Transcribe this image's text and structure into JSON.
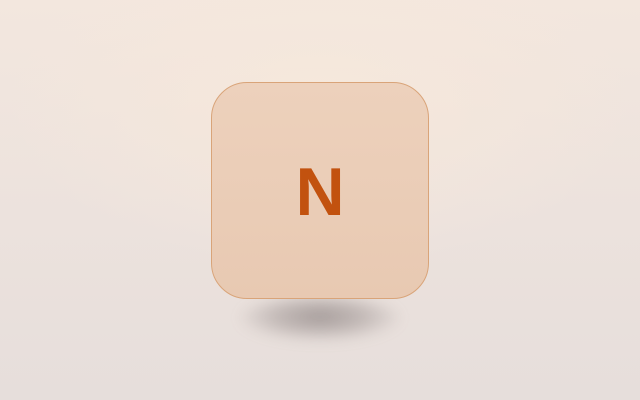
{
  "app_icon": {
    "letter": "N",
    "icon_name": "n-app-icon",
    "colors": {
      "letter": "#c2520f",
      "tile": "#eacdb7",
      "border": "#d9a479",
      "background": "#efe4dc"
    }
  }
}
